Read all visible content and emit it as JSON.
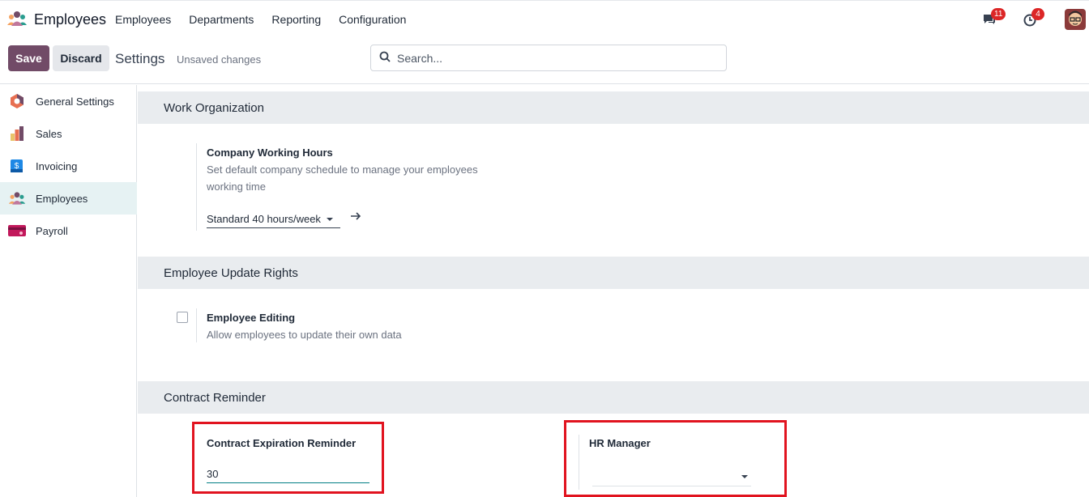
{
  "navbar": {
    "app_name": "Employees",
    "menu": [
      "Employees",
      "Departments",
      "Reporting",
      "Configuration"
    ],
    "messages_count": "11",
    "activities_count": "4"
  },
  "control_bar": {
    "save_label": "Save",
    "discard_label": "Discard",
    "title": "Settings",
    "status": "Unsaved changes",
    "search_placeholder": "Search..."
  },
  "sidebar": {
    "items": [
      {
        "label": "General Settings",
        "icon": "hexagon-logo-icon"
      },
      {
        "label": "Sales",
        "icon": "sales-chart-icon"
      },
      {
        "label": "Invoicing",
        "icon": "invoice-icon"
      },
      {
        "label": "Employees",
        "icon": "employees-icon",
        "active": true
      },
      {
        "label": "Payroll",
        "icon": "payroll-icon"
      }
    ]
  },
  "sections": {
    "work_org": {
      "title": "Work Organization",
      "working_hours": {
        "title": "Company Working Hours",
        "desc_line1": "Set default company schedule to manage your employees",
        "desc_line2": "working time",
        "value": "Standard 40 hours/week"
      }
    },
    "update_rights": {
      "title": "Employee Update Rights",
      "editing": {
        "title": "Employee Editing",
        "desc": "Allow employees to update their own data",
        "checked": false
      }
    },
    "contract": {
      "title": "Contract Reminder",
      "expiration": {
        "title": "Contract Expiration Reminder",
        "value": "30"
      },
      "hr_manager": {
        "title": "HR Manager",
        "value": ""
      }
    }
  },
  "colors": {
    "brand": "#714b67",
    "accent": "#017e84",
    "highlight_box": "#e1131f"
  }
}
